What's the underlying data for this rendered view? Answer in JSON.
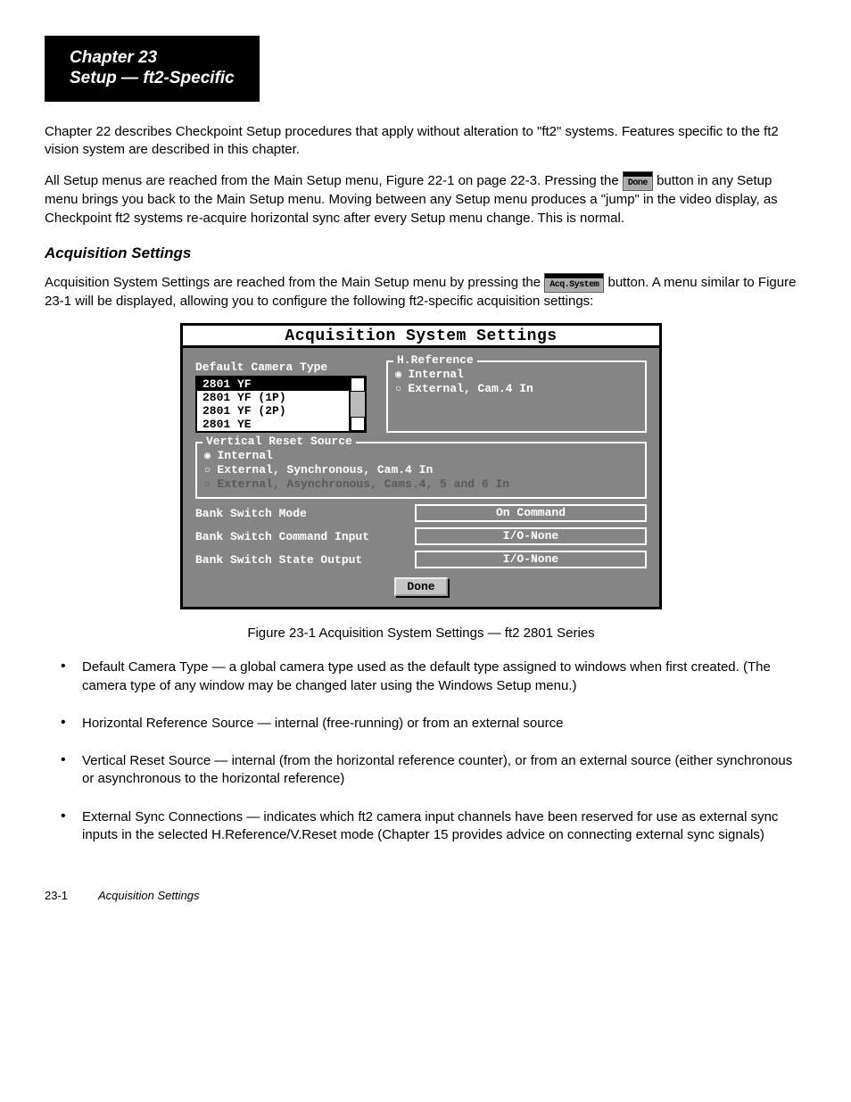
{
  "header": {
    "chapter_line": "Chapter 23",
    "title_line": "Setup — ft2-Specific"
  },
  "body": {
    "p1": "Chapter 22 describes Checkpoint Setup procedures that apply without alteration to \"ft2\" systems. Features specific to the ft2 vision system are described in this chapter.",
    "p2_a": "All Setup menus are reached from the Main Setup menu, Figure 22-1 on page 22-3. Pressing the ",
    "p2_b": " button in any Setup menu brings you back to the Main Setup menu. Moving between any Setup menu produces a \"jump\" in the video display, as Checkpoint ft2 systems re-acquire horizontal sync after every Setup menu change. This is normal.",
    "done_btn": "Done",
    "h3": "Acquisition Settings",
    "p3_a": "Acquisition System Settings are reached from the Main Setup menu by pressing the ",
    "p3_b": " button. A menu similar to Figure 23-1 will be displayed, allowing you to configure the following ft2-specific acquisition settings:",
    "acq_btn": "Acq.System"
  },
  "dialog": {
    "title": "Acquisition System Settings",
    "default_camera_label": "Default Camera Type",
    "camera_options": [
      "2801 YF",
      "2801 YF (1P)",
      "2801 YF (2P)",
      "2801 YE"
    ],
    "href_legend": "H.Reference",
    "href_opts": [
      "Internal",
      "External, Cam.4 In"
    ],
    "vrs_legend": "Vertical Reset Source",
    "vrs_opts": [
      "Internal",
      "External, Synchronous, Cam.4 In",
      "External, Asynchronous, Cams.4, 5 and 6 In"
    ],
    "rows": [
      {
        "label": "Bank Switch Mode",
        "value": "On Command"
      },
      {
        "label": "Bank Switch Command Input",
        "value": "I/O-None"
      },
      {
        "label": "Bank Switch State Output",
        "value": "I/O-None"
      }
    ],
    "done": "Done"
  },
  "caption": "Figure 23-1    Acquisition System Settings — ft2 2801 Series",
  "bullets": [
    "Default Camera Type — a global camera type used as the default type assigned to windows when first created. (The camera type of any window may be changed later using the Windows Setup menu.)",
    "Horizontal Reference Source — internal (free-running) or from an external source",
    "Vertical Reset Source — internal (from the horizontal reference counter), or from an external source (either synchronous or asynchronous to the horizontal reference)",
    "External Sync Connections — indicates which ft2 camera input channels have been reserved for use as external sync inputs in the selected H.Reference/V.Reset mode (Chapter 15 provides advice on connecting external sync signals)"
  ],
  "footer": {
    "page": "23-1",
    "author": "Acquisition Settings"
  }
}
